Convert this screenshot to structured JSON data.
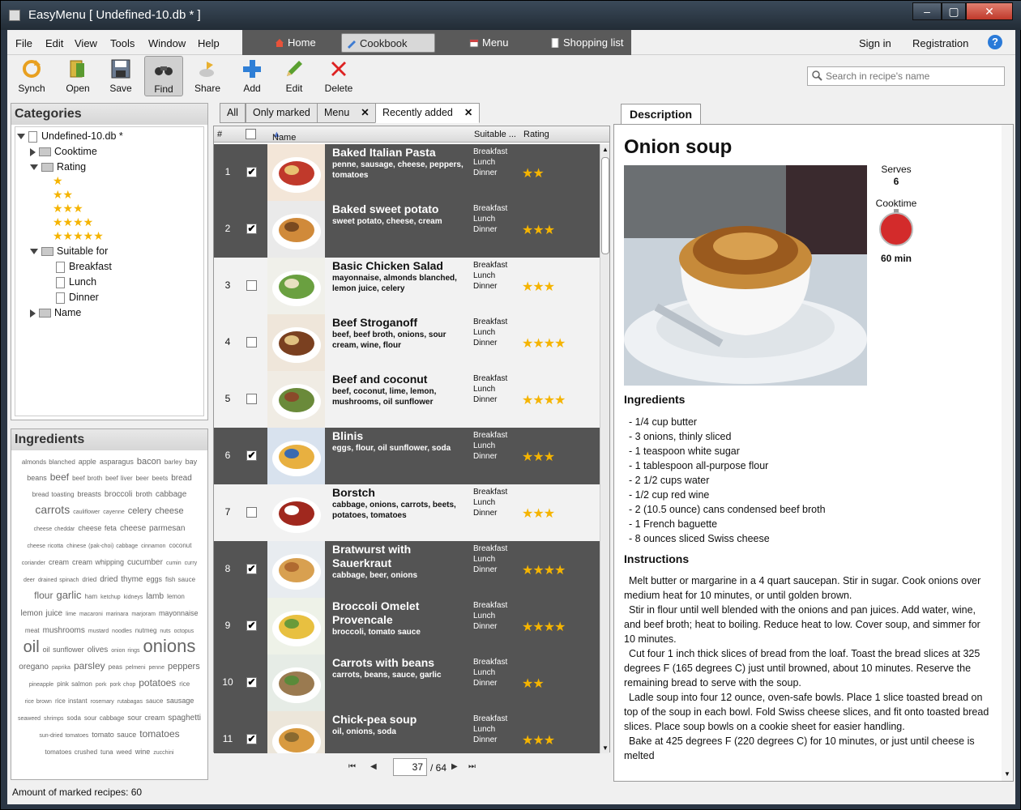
{
  "window": {
    "title": "EasyMenu [ Undefined-10.db * ]",
    "min": "–",
    "max": "▢",
    "close": "✕"
  },
  "menu": [
    "File",
    "Edit",
    "View",
    "Tools",
    "Window",
    "Help"
  ],
  "nav": {
    "home": "Home",
    "cookbook": "Cookbook",
    "menu": "Menu",
    "shopping": "Shopping list",
    "active": "Cookbook"
  },
  "auth": {
    "signin": "Sign in",
    "registration": "Registration",
    "help": "?"
  },
  "toolbar": [
    "Synch",
    "Open",
    "Save",
    "Find",
    "Share",
    "Add",
    "Edit",
    "Delete"
  ],
  "search": {
    "placeholder": "Search in recipe's name"
  },
  "categories": {
    "title": "Categories",
    "root": "Undefined-10.db *",
    "cooktime": "Cooktime",
    "rating": "Rating",
    "rating_levels": [
      "★",
      "★★",
      "★★★",
      "★★★★",
      "★★★★★"
    ],
    "suitable": "Suitable for",
    "breakfast": "Breakfast",
    "lunch": "Lunch",
    "dinner": "Dinner",
    "name": "Name"
  },
  "ingredients_panel": {
    "title": "Ingredients"
  },
  "tags": [
    [
      "almonds blanched",
      8
    ],
    [
      "apple",
      9
    ],
    [
      "asparagus",
      9
    ],
    [
      "bacon",
      11
    ],
    [
      "barley",
      8
    ],
    [
      "bay",
      9
    ],
    [
      "beans",
      9
    ],
    [
      "beef",
      12
    ],
    [
      "beef broth",
      8
    ],
    [
      "beef liver",
      8
    ],
    [
      "beer",
      8
    ],
    [
      "beets",
      8
    ],
    [
      "bread",
      10
    ],
    [
      "bread toasting",
      8
    ],
    [
      "breasts",
      9
    ],
    [
      "broccoli",
      10
    ],
    [
      "broth",
      9
    ],
    [
      "cabbage",
      10
    ],
    [
      "carrots",
      14
    ],
    [
      "cauliflower",
      7
    ],
    [
      "cayenne",
      7
    ],
    [
      "celery",
      11
    ],
    [
      "cheese",
      11
    ],
    [
      "cheese cheddar",
      7
    ],
    [
      "cheese feta",
      9
    ],
    [
      "cheese parmesan",
      10
    ],
    [
      "cheese ricotta",
      7
    ],
    [
      "chinese (pak-choi) cabbage",
      7
    ],
    [
      "cinnamon",
      7
    ],
    [
      "coconut",
      8
    ],
    [
      "coriander",
      7
    ],
    [
      "cream",
      9
    ],
    [
      "cream whipping",
      9
    ],
    [
      "cucumber",
      10
    ],
    [
      "cumin",
      7
    ],
    [
      "curry",
      7
    ],
    [
      "deer",
      7
    ],
    [
      "drained spinach",
      7
    ],
    [
      "dried",
      8
    ],
    [
      "dried thyme",
      10
    ],
    [
      "eggs",
      9
    ],
    [
      "fish sauce",
      8
    ],
    [
      "flour",
      12
    ],
    [
      "garlic",
      13
    ],
    [
      "ham",
      8
    ],
    [
      "ketchup",
      7
    ],
    [
      "kidneys",
      7
    ],
    [
      "lamb",
      10
    ],
    [
      "lemon",
      8
    ],
    [
      "lemon juice",
      10
    ],
    [
      "lime",
      7
    ],
    [
      "macaroni",
      7
    ],
    [
      "marinara",
      7
    ],
    [
      "marjoram",
      7
    ],
    [
      "mayonnaise",
      9
    ],
    [
      "meat",
      8
    ],
    [
      "mushrooms",
      10
    ],
    [
      "mustard",
      7
    ],
    [
      "noodles",
      7
    ],
    [
      "nutmeg",
      8
    ],
    [
      "nuts",
      7
    ],
    [
      "octopus",
      7
    ],
    [
      "oil",
      20
    ],
    [
      "oil sunflower",
      9
    ],
    [
      "olives",
      10
    ],
    [
      "onion rings",
      7
    ],
    [
      "onions",
      22
    ],
    [
      "oregano",
      10
    ],
    [
      "paprika",
      7
    ],
    [
      "parsley",
      12
    ],
    [
      "peas",
      8
    ],
    [
      "pelmeni",
      7
    ],
    [
      "penne",
      7
    ],
    [
      "peppers",
      11
    ],
    [
      "pineapple",
      7
    ],
    [
      "pink salmon",
      8
    ],
    [
      "pork",
      7
    ],
    [
      "pork chop",
      7
    ],
    [
      "potatoes",
      12
    ],
    [
      "rice",
      8
    ],
    [
      "rice brown",
      7
    ],
    [
      "rice instant",
      8
    ],
    [
      "rosemary",
      7
    ],
    [
      "rutabagas",
      7
    ],
    [
      "sauce",
      8
    ],
    [
      "sausage",
      9
    ],
    [
      "seaweed",
      7
    ],
    [
      "shrimps",
      7
    ],
    [
      "soda",
      8
    ],
    [
      "sour cabbage",
      8
    ],
    [
      "sour cream",
      9
    ],
    [
      "spaghetti",
      10
    ],
    [
      "sun-dried tomatoes",
      7
    ],
    [
      "tomato sauce",
      9
    ],
    [
      "tomatoes",
      12
    ],
    [
      "tomatoes crushed",
      8
    ],
    [
      "tuna",
      8
    ],
    [
      "weed",
      8
    ],
    [
      "wine",
      9
    ],
    [
      "zucchini",
      7
    ]
  ],
  "tabs": [
    "All",
    "Only marked",
    "Menu",
    "Recently added"
  ],
  "list_header": {
    "num": "#",
    "name": "Name",
    "suitable": "Suitable ...",
    "rating": "Rating"
  },
  "recipes": [
    {
      "n": "1",
      "name": "Baked Italian Pasta",
      "ing": "penne, sausage, cheese, peppers, tomatoes",
      "suit": [
        "Breakfast",
        "Lunch",
        "Dinner"
      ],
      "rating": 2,
      "checked": true,
      "dark": true,
      "stars": "★★"
    },
    {
      "n": "2",
      "name": "Baked sweet potato",
      "ing": "sweet potato, cheese, cream",
      "suit": [
        "Breakfast",
        "Lunch",
        "Dinner"
      ],
      "rating": 3,
      "checked": true,
      "dark": true,
      "stars": "★★★"
    },
    {
      "n": "3",
      "name": "Basic Chicken Salad",
      "ing": "mayonnaise, almonds blanched, lemon juice, celery",
      "suit": [
        "Breakfast",
        "Lunch",
        "Dinner"
      ],
      "rating": 3,
      "checked": false,
      "dark": false,
      "stars": "★★★"
    },
    {
      "n": "4",
      "name": "Beef Stroganoff",
      "ing": "beef, beef broth, onions, sour cream, wine, flour",
      "suit": [
        "Breakfast",
        "Lunch",
        "Dinner"
      ],
      "rating": 4,
      "checked": false,
      "dark": false,
      "stars": "★★★★"
    },
    {
      "n": "5",
      "name": "Beef and coconut",
      "ing": "beef, coconut, lime, lemon, mushrooms, oil sunflower",
      "suit": [
        "Breakfast",
        "Lunch",
        "Dinner"
      ],
      "rating": 4,
      "checked": false,
      "dark": false,
      "stars": "★★★★"
    },
    {
      "n": "6",
      "name": "Blinis",
      "ing": "eggs, flour, oil sunflower, soda",
      "suit": [
        "Breakfast",
        "Lunch",
        "Dinner"
      ],
      "rating": 3,
      "checked": true,
      "dark": true,
      "stars": "★★★"
    },
    {
      "n": "7",
      "name": "Borstch",
      "ing": "cabbage, onions, carrots, beets, potatoes, tomatoes",
      "suit": [
        "Breakfast",
        "Lunch",
        "Dinner"
      ],
      "rating": 3,
      "checked": false,
      "dark": false,
      "stars": "★★★"
    },
    {
      "n": "8",
      "name": "Bratwurst with Sauerkraut",
      "ing": "cabbage, beer, onions",
      "suit": [
        "Breakfast",
        "Lunch",
        "Dinner"
      ],
      "rating": 4,
      "checked": true,
      "dark": true,
      "stars": "★★★★"
    },
    {
      "n": "9",
      "name": "Broccoli Omelet Provencale",
      "ing": "broccoli, tomato sauce",
      "suit": [
        "Breakfast",
        "Lunch",
        "Dinner"
      ],
      "rating": 4,
      "checked": true,
      "dark": true,
      "stars": "★★★★"
    },
    {
      "n": "10",
      "name": "Carrots with beans",
      "ing": "carrots, beans, sauce, garlic",
      "suit": [
        "Breakfast",
        "Lunch",
        "Dinner"
      ],
      "rating": 2,
      "checked": true,
      "dark": true,
      "stars": "★★"
    },
    {
      "n": "11",
      "name": "Chick-pea soup",
      "ing": "oil, onions, soda",
      "suit": [
        "Breakfast",
        "Lunch",
        "Dinner"
      ],
      "rating": 3,
      "checked": true,
      "dark": true,
      "stars": "★★★"
    }
  ],
  "pager": {
    "first": "⏮",
    "prev": "◀",
    "page": "37",
    "total": "/ 64",
    "next": "▶",
    "last": "⏭"
  },
  "description": {
    "tab": "Description",
    "title": "Onion soup",
    "serves_label": "Serves",
    "serves": "6",
    "cooktime_label": "Cooktime",
    "cooktime": "60 min",
    "ingredients_title": "Ingredients",
    "ingredients": [
      "- 1/4 cup butter",
      "- 3 onions, thinly sliced",
      "- 1 teaspoon white sugar",
      "- 1 tablespoon all-purpose flour",
      "- 2 1/2 cups water",
      "- 1/2 cup red wine",
      "- 2 (10.5 ounce) cans condensed beef broth",
      "- 1 French baguette",
      "- 8 ounces sliced Swiss cheese"
    ],
    "instructions_title": "Instructions",
    "instructions": [
      "Melt butter or margarine in a 4 quart saucepan. Stir in sugar. Cook onions over medium heat for 10 minutes, or until golden brown.",
      "Stir in flour until well blended with the onions and pan juices. Add water, wine, and beef broth; heat to boiling. Reduce heat to low. Cover soup, and simmer for 10 minutes.",
      "Cut four 1 inch thick slices of bread from the loaf. Toast the bread slices at 325 degrees F (165 degrees C) just until browned, about 10 minutes. Reserve the remaining bread to serve with the soup.",
      "Ladle soup into four 12 ounce, oven-safe bowls. Place 1 slice toasted bread on top of the soup in each bowl. Fold Swiss cheese slices, and fit onto toasted bread slices. Place soup bowls on a cookie sheet for easier handling.",
      "Bake at 425 degrees F (220 degrees C) for 10 minutes, or just until cheese is melted"
    ]
  },
  "status": "Amount of marked recipes: 60",
  "colors": {
    "accent": "#2a7ad8",
    "star": "#f5b400",
    "dark_row": "#545454",
    "timer": "#d32b2b"
  }
}
